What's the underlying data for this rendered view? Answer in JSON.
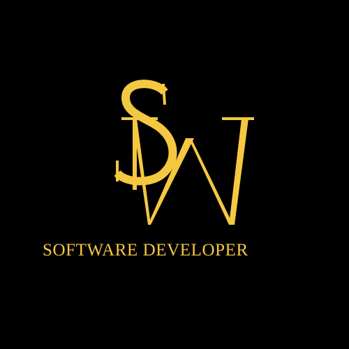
{
  "logo": {
    "monogram_letters": "SW",
    "tagline": "SOFTWARE DEVELOPER"
  },
  "colors": {
    "background": "#000000",
    "gold": "#f5c842"
  }
}
